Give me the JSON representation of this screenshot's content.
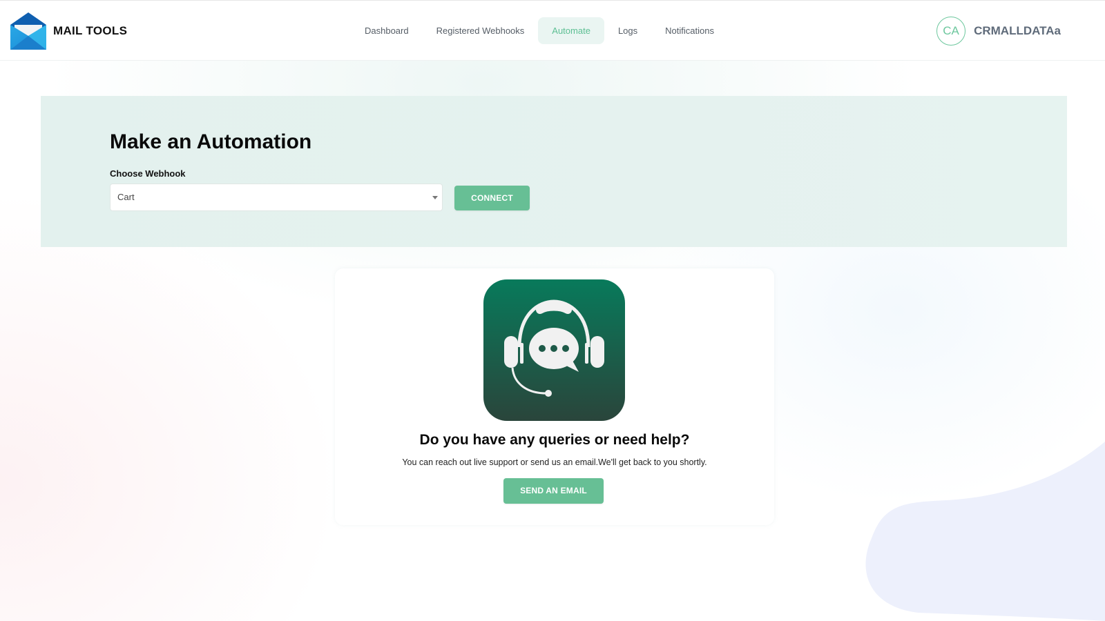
{
  "brand": {
    "name": "MAIL TOOLS",
    "logo_icon": "envelope-icon"
  },
  "nav": {
    "items": [
      {
        "label": "Dashboard",
        "active": false
      },
      {
        "label": "Registered Webhooks",
        "active": false
      },
      {
        "label": "Automate",
        "active": true
      },
      {
        "label": "Logs",
        "active": false
      },
      {
        "label": "Notifications",
        "active": false
      }
    ]
  },
  "user": {
    "initials": "CA",
    "name": "CRMALLDATAa"
  },
  "automation": {
    "title": "Make an Automation",
    "webhook_label": "Choose Webhook",
    "webhook_selected": "Cart",
    "connect_label": "CONNECT"
  },
  "support": {
    "icon": "headset-chat-icon",
    "heading": "Do you have any queries or need help?",
    "text": "You can reach out live support or send us an email.We'll get back to you shortly.",
    "button_label": "SEND AN EMAIL"
  },
  "colors": {
    "accent": "#67bf95",
    "nav_active_bg": "#eaf5f2",
    "hero_bg": "#e4f2ef",
    "icon_gradient_top": "#087a5b",
    "icon_gradient_bottom": "#27473d"
  }
}
